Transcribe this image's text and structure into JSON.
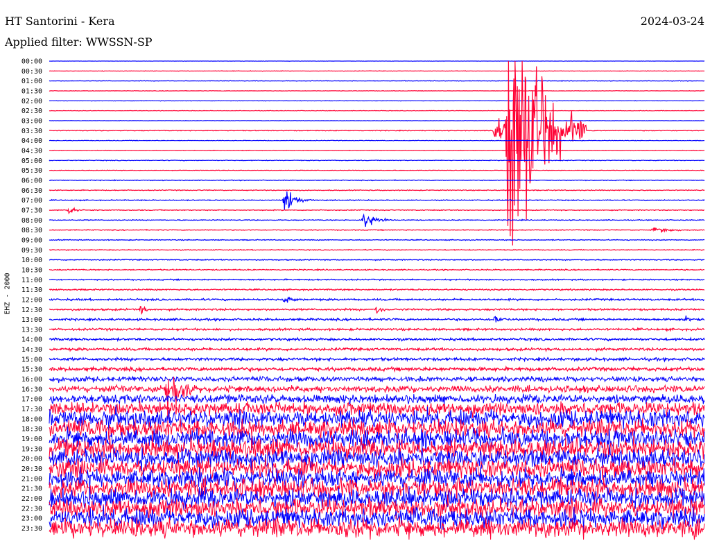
{
  "header": {
    "station": "HT Santorini - Kera",
    "date": "2024-03-24",
    "filter": "Applied filter: WWSSN-SP"
  },
  "chart_data": {
    "type": "line",
    "title": "HT Santorini - Kera",
    "subtitle": "Applied filter: WWSSN-SP",
    "ylabel": "EHZ - 2000",
    "grid": false,
    "colors": [
      "#0000ff",
      "#ff0033"
    ],
    "row_labels": [
      "00:00",
      "00:30",
      "01:00",
      "01:30",
      "02:00",
      "02:30",
      "03:00",
      "03:30",
      "04:00",
      "04:30",
      "05:00",
      "05:30",
      "06:00",
      "06:30",
      "07:00",
      "07:30",
      "08:00",
      "08:30",
      "09:00",
      "09:30",
      "10:00",
      "10:30",
      "11:00",
      "11:30",
      "12:00",
      "12:30",
      "13:00",
      "13:30",
      "14:00",
      "14:30",
      "15:00",
      "15:30",
      "16:00",
      "16:30",
      "17:00",
      "17:30",
      "18:00",
      "18:30",
      "19:00",
      "19:30",
      "20:00",
      "20:30",
      "21:00",
      "21:30",
      "22:00",
      "22:30",
      "23:00",
      "23:30"
    ],
    "noise_levels": [
      0.3,
      0.3,
      0.3,
      0.3,
      0.3,
      0.3,
      0.3,
      0.5,
      0.4,
      0.4,
      0.5,
      0.4,
      0.5,
      0.6,
      0.7,
      0.6,
      0.6,
      0.6,
      0.6,
      0.6,
      0.7,
      0.8,
      0.9,
      1.0,
      1.3,
      1.3,
      1.5,
      1.5,
      1.7,
      1.8,
      2.0,
      2.5,
      3.5,
      4.5,
      6,
      9,
      12,
      12,
      13,
      13,
      13,
      13,
      13,
      13,
      13,
      13,
      13,
      13
    ],
    "events": [
      {
        "row": 7,
        "t": 0.68,
        "amp": 28,
        "dur": 0.02
      },
      {
        "row": 7,
        "t": 0.7,
        "amp": 320,
        "dur": 0.04
      },
      {
        "row": 14,
        "t": 0.36,
        "amp": 22,
        "dur": 0.015
      },
      {
        "row": 15,
        "t": 0.03,
        "amp": 8,
        "dur": 0.01
      },
      {
        "row": 16,
        "t": 0.48,
        "amp": 20,
        "dur": 0.015
      },
      {
        "row": 17,
        "t": 0.92,
        "amp": 9,
        "dur": 0.02
      },
      {
        "row": 24,
        "t": 0.36,
        "amp": 9,
        "dur": 0.01
      },
      {
        "row": 25,
        "t": 0.14,
        "amp": 9,
        "dur": 0.01
      },
      {
        "row": 25,
        "t": 0.5,
        "amp": 9,
        "dur": 0.01
      },
      {
        "row": 26,
        "t": 0.68,
        "amp": 9,
        "dur": 0.01
      },
      {
        "row": 26,
        "t": 0.97,
        "amp": 7,
        "dur": 0.01
      },
      {
        "row": 33,
        "t": 0.18,
        "amp": 75,
        "dur": 0.015
      }
    ]
  }
}
